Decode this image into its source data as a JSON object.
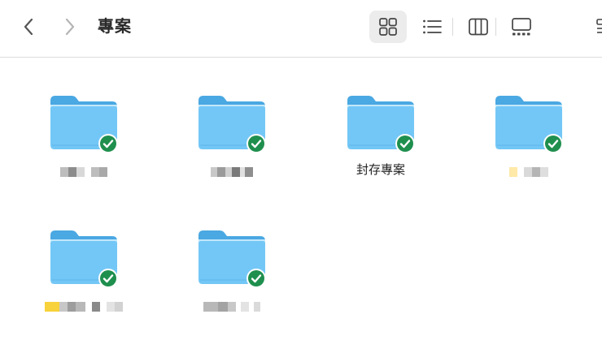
{
  "window": {
    "title": "專案",
    "icons": {
      "back": "chevron-left-icon",
      "forward": "chevron-right-icon",
      "icon_view": "grid-icon",
      "list_view": "list-icon",
      "column_view": "columns-icon",
      "gallery_view": "gallery-icon",
      "group": "group-icon"
    },
    "active_view": "icon"
  },
  "colors": {
    "folder_body": "#73c7f6",
    "folder_back": "#4aa8e2",
    "badge": "#1f8f4e",
    "accent_active_bg": "#ececec"
  },
  "folders": [
    {
      "label": "",
      "redacted": true,
      "sync_status": "synced"
    },
    {
      "label": "",
      "redacted": true,
      "sync_status": "synced"
    },
    {
      "label": "封存專案",
      "redacted": false,
      "sync_status": "synced"
    },
    {
      "label": "",
      "redacted": true,
      "sync_status": "synced"
    },
    {
      "label": "",
      "redacted": true,
      "sync_status": "synced"
    },
    {
      "label": "",
      "redacted": true,
      "sync_status": "synced"
    }
  ]
}
